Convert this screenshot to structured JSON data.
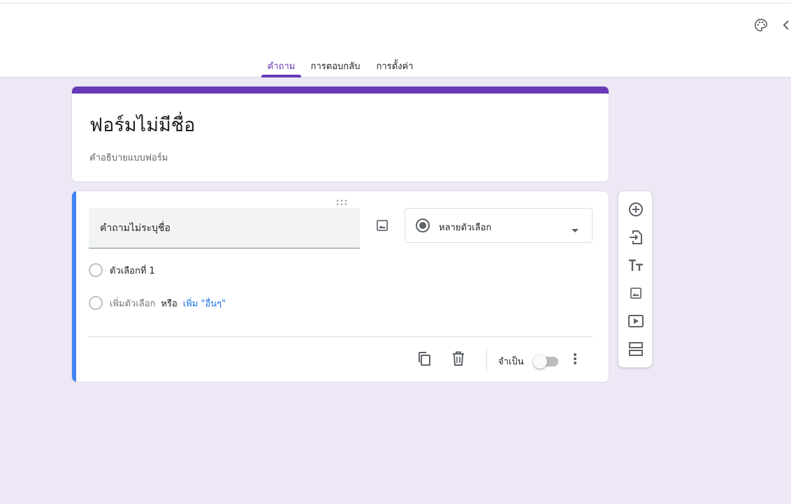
{
  "header": {
    "palette_icon": "palette-icon",
    "preview_icon": "chevron-left-icon"
  },
  "tabs": [
    {
      "label": "คำถาม",
      "active": true
    },
    {
      "label": "การตอบกลับ",
      "active": false
    },
    {
      "label": "การตั้งค่า",
      "active": false
    }
  ],
  "colors": {
    "accent": "#673ab7",
    "background": "#ede7f6",
    "question_focus_bar": "#4285f4",
    "link": "#1a73e8"
  },
  "form": {
    "title": "ฟอร์มไม่มีชื่อ",
    "description": "คำอธิบายแบบฟอร์ม"
  },
  "question": {
    "title": "คำถามไม่ระบุชื่อ",
    "type": "หลายตัวเลือก",
    "options": [
      {
        "label": "ตัวเลือกที่ 1"
      }
    ],
    "add_option": "เพิ่มตัวเลือก",
    "or_text": "หรือ",
    "add_other": "เพิ่ม \"อื่นๆ\"",
    "required_label": "จำเป็น",
    "required": false
  },
  "side_toolbar": [
    {
      "icon": "add-circle-icon"
    },
    {
      "icon": "import-icon"
    },
    {
      "icon": "title-text-icon"
    },
    {
      "icon": "image-icon"
    },
    {
      "icon": "video-icon"
    },
    {
      "icon": "section-icon"
    }
  ]
}
